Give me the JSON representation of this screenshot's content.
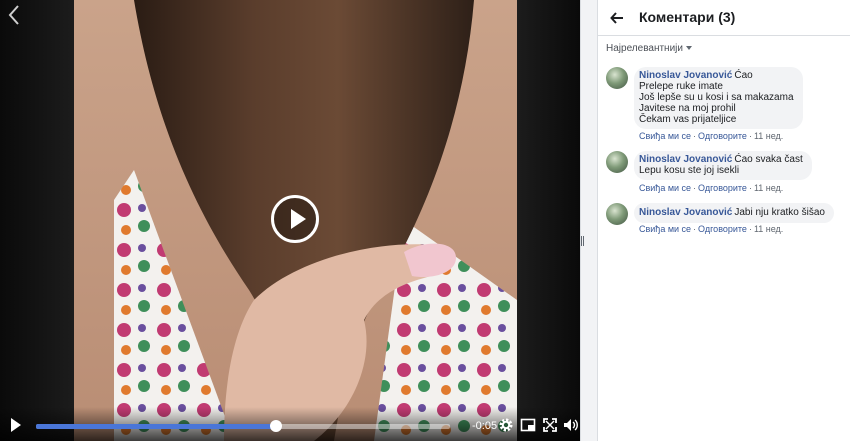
{
  "player": {
    "time_remaining": "-0:05",
    "progress": 0.58,
    "accent_color": "#4a76d8",
    "icons": [
      "chevron-left-icon",
      "play-icon",
      "settings-icon",
      "pip-icon",
      "fullscreen-icon",
      "volume-icon"
    ]
  },
  "panel": {
    "title": "Коментари (3)",
    "sort_label": "Најрелевантнији"
  },
  "comments": [
    {
      "author": "Ninoslav Jovanović",
      "first_line": "Ćao",
      "lines": [
        "Prelepe ruke imate",
        "Još lepše su u kosi i sa makazama",
        "Javitese na moj prohil",
        "Čekam vas prijateljice"
      ],
      "like": "Свиђа ми се",
      "reply": "Одговорите",
      "time": "11 нед."
    },
    {
      "author": "Ninoslav Jovanović",
      "first_line": "Ćao svaka čast",
      "lines": [
        "Lepu kosu ste joj isekli"
      ],
      "like": "Свиђа ми се",
      "reply": "Одговорите",
      "time": "11 нед."
    },
    {
      "author": "Ninoslav Jovanović",
      "first_line": "Jabi nju kratko šišao",
      "lines": [],
      "like": "Свиђа ми се",
      "reply": "Одговорите",
      "time": "11 нед."
    }
  ]
}
